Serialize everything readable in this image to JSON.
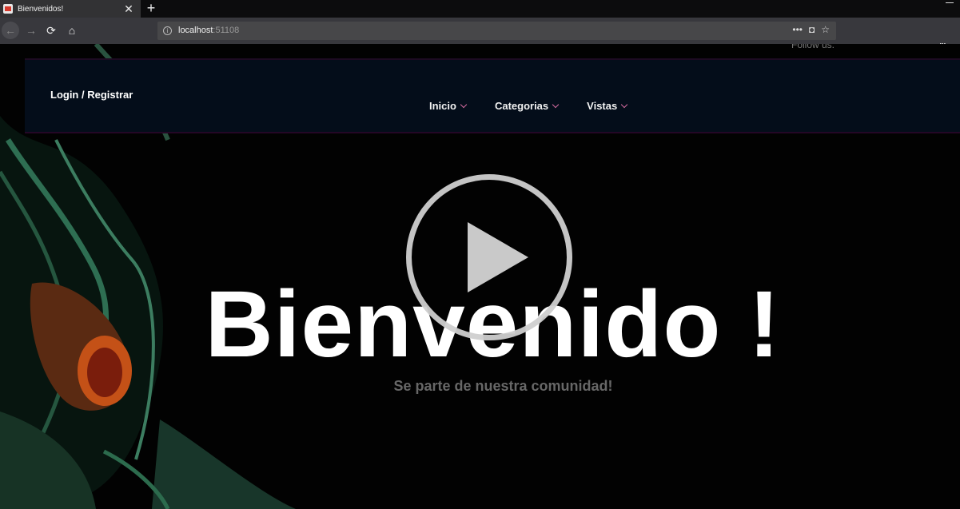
{
  "browser": {
    "tab_title": "Bienvenidos!",
    "tab_close": "✕",
    "new_tab": "+",
    "url_host": "localhost",
    "url_port": ":51108",
    "icons": [
      "back-icon",
      "forward-icon",
      "reload-icon",
      "home-icon",
      "info-icon",
      "more-icon",
      "pocket-icon",
      "bookmark-star-icon",
      "download-icon",
      "library-icon",
      "sidebar-icon"
    ]
  },
  "header": {
    "follow_label": "Follow us:",
    "login_label": "Login / Registrar",
    "menu": [
      {
        "label": "Inicio"
      },
      {
        "label": "Categorias"
      },
      {
        "label": "Vistas"
      }
    ]
  },
  "hero": {
    "title": "Bienvenido !",
    "subtitle": "Se parte de nuestra comunidad!"
  },
  "colors": {
    "header_bg": "#040d1a",
    "accent_chevron": "#d06a9d",
    "subtitle": "#676767"
  }
}
